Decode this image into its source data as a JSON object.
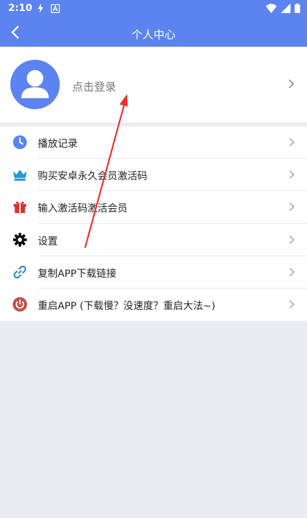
{
  "status_bar": {
    "time": "2:10"
  },
  "app_bar": {
    "title": "个人中心"
  },
  "profile": {
    "login_text": "点击登录"
  },
  "menu": {
    "items": [
      {
        "label": "播放记录",
        "icon": "clock-icon",
        "color": "#5b84f0"
      },
      {
        "label": "购买安卓永久会员激活码",
        "icon": "crown-icon",
        "color": "#1e9ad6"
      },
      {
        "label": "输入激活码激活会员",
        "icon": "gift-icon",
        "color": "#d9342b"
      },
      {
        "label": "设置",
        "icon": "gear-icon",
        "color": "#111111"
      },
      {
        "label": "复制APP下载链接",
        "icon": "link-icon",
        "color": "#2a86c8"
      },
      {
        "label": "重启APP (下载慢？没速度？重启大法~)",
        "icon": "power-icon",
        "color": "#c0524a"
      }
    ]
  },
  "colors": {
    "accent": "#5b84f0",
    "background": "#e9edf3",
    "annotation_arrow": "#ee2b2b"
  }
}
